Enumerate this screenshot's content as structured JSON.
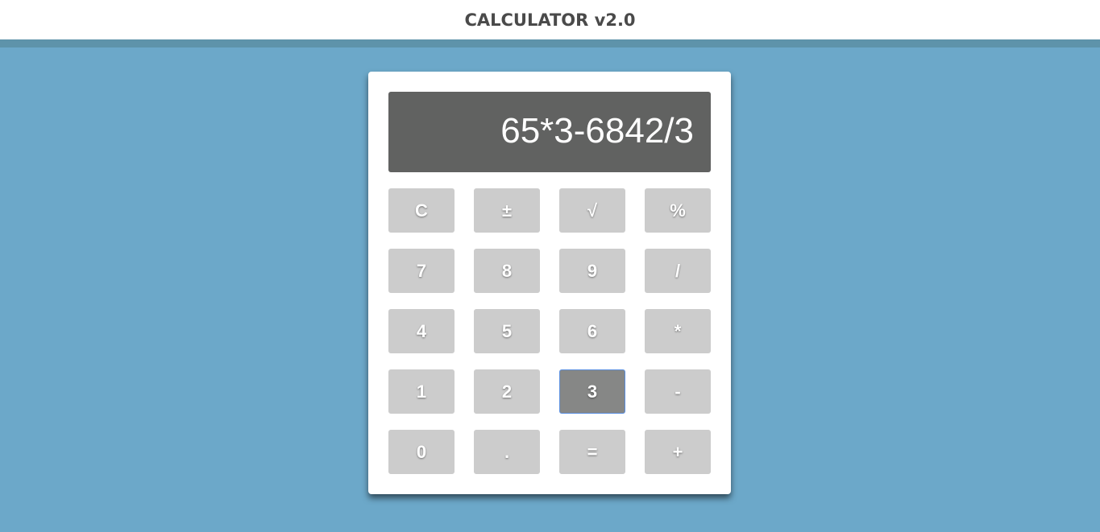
{
  "header": {
    "title": "CALCULATOR v2.0"
  },
  "display": {
    "value": "65*3-6842/3"
  },
  "keys": [
    {
      "label": "C",
      "name": "clear-button"
    },
    {
      "label": "±",
      "name": "plus-minus-button"
    },
    {
      "label": "√",
      "name": "sqrt-button"
    },
    {
      "label": "%",
      "name": "percent-button"
    },
    {
      "label": "7",
      "name": "digit-7-button"
    },
    {
      "label": "8",
      "name": "digit-8-button"
    },
    {
      "label": "9",
      "name": "digit-9-button"
    },
    {
      "label": "/",
      "name": "divide-button"
    },
    {
      "label": "4",
      "name": "digit-4-button"
    },
    {
      "label": "5",
      "name": "digit-5-button"
    },
    {
      "label": "6",
      "name": "digit-6-button"
    },
    {
      "label": "*",
      "name": "multiply-button"
    },
    {
      "label": "1",
      "name": "digit-1-button"
    },
    {
      "label": "2",
      "name": "digit-2-button"
    },
    {
      "label": "3",
      "name": "digit-3-button",
      "active": true
    },
    {
      "label": "-",
      "name": "subtract-button"
    },
    {
      "label": "0",
      "name": "digit-0-button"
    },
    {
      "label": ".",
      "name": "decimal-button"
    },
    {
      "label": "=",
      "name": "equals-button"
    },
    {
      "label": "+",
      "name": "add-button"
    }
  ],
  "colors": {
    "background": "#6ca8c9",
    "header_rule": "#5e93aa",
    "display_bg": "#616261",
    "key_bg": "#cccccc",
    "key_active_bg": "#868786",
    "key_active_border": "#5a8fe0"
  }
}
